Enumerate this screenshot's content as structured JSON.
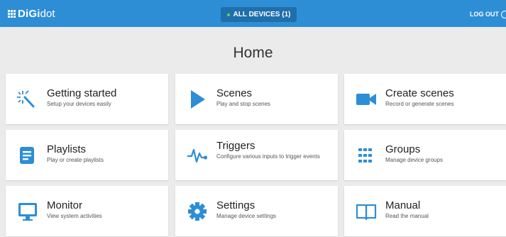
{
  "header": {
    "brand_bold": "DiGi",
    "brand_light": "dot",
    "devices_label": "ALL DEVICES (1)",
    "logout_label": "LOG OUT"
  },
  "page": {
    "title": "Home"
  },
  "cards": [
    {
      "title": "Getting started",
      "subtitle": "Setup your devices easily",
      "icon": "magic-wand-icon"
    },
    {
      "title": "Scenes",
      "subtitle": "Play and stop scenes",
      "icon": "play-icon"
    },
    {
      "title": "Create scenes",
      "subtitle": "Record or generate scenes",
      "icon": "video-camera-icon"
    },
    {
      "title": "Playlists",
      "subtitle": "Play or create playlists",
      "icon": "playlist-icon"
    },
    {
      "title": "Triggers",
      "subtitle": "Configure various inputs to trigger events",
      "icon": "pulse-icon"
    },
    {
      "title": "Groups",
      "subtitle": "Manage device groups",
      "icon": "grid-icon"
    },
    {
      "title": "Monitor",
      "subtitle": "View system activities",
      "icon": "monitor-icon"
    },
    {
      "title": "Settings",
      "subtitle": "Manage device settings",
      "icon": "gear-icon"
    },
    {
      "title": "Manual",
      "subtitle": "Read the manual",
      "icon": "book-icon"
    }
  ],
  "colors": {
    "accent": "#2d8ed6",
    "header_dark": "#1f6fab",
    "background": "#ebebeb"
  }
}
